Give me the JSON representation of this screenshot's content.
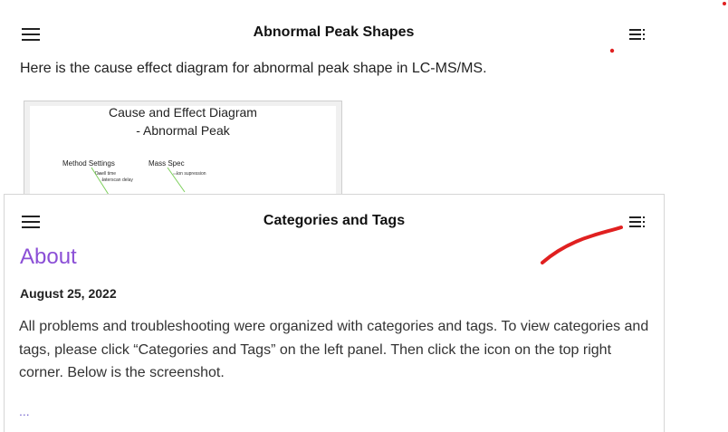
{
  "top": {
    "title": "Abnormal Peak Shapes",
    "intro": "Here is the cause effect diagram for abnormal peak shape in LC-MS/MS.",
    "diagram": {
      "title_line1": "Cause and Effect Diagram",
      "title_line2": "- Abnormal Peak",
      "label_method": "Method Settings",
      "label_mass": "Mass Spec",
      "sub_dwell": "Dwell time",
      "sub_interscan": "Interscan delay",
      "sub_ion": "Ion supression"
    }
  },
  "card": {
    "title": "Categories and Tags",
    "heading": "About",
    "date": "August 25, 2022",
    "body": "All problems and troubleshooting were organized with categories and tags. To view categories and tags, please click “Categories and Tags” on the left panel. Then click the icon on the top right corner. Below is the screenshot.",
    "more": "..."
  },
  "colors": {
    "accent": "#8b4fd6",
    "annotation": "#e02020",
    "diagram_line": "#7ccf5a"
  },
  "icons": {
    "menu": "hamburger-menu-icon",
    "toc": "table-of-contents-icon"
  }
}
